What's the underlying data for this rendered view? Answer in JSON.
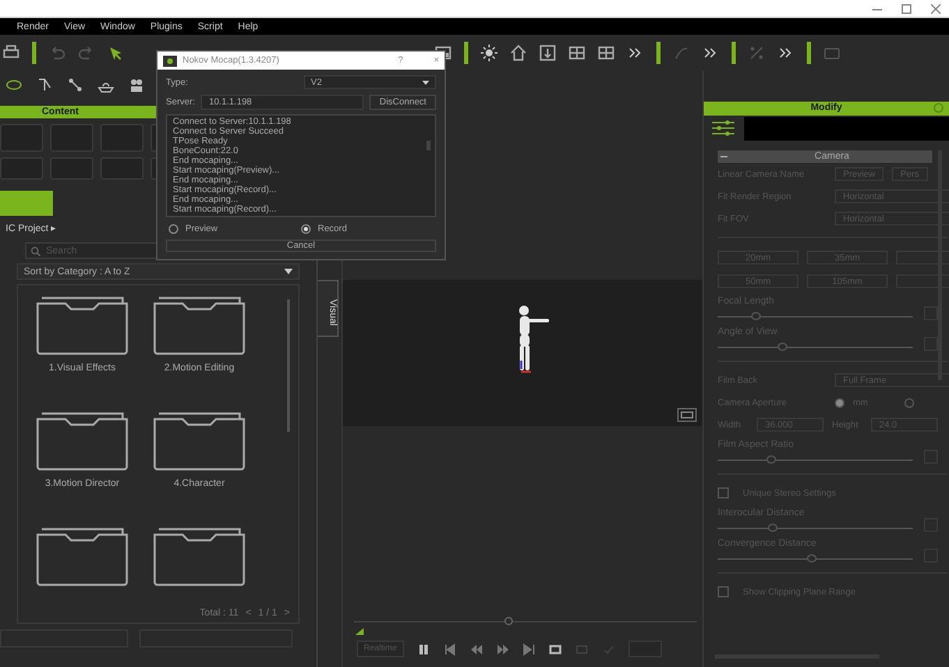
{
  "menu": [
    "Render",
    "View",
    "Window",
    "Plugins",
    "Script",
    "Help"
  ],
  "content_panel": {
    "title": "Content",
    "project": "IC Project ▸",
    "search": {
      "placeholder": "Search"
    },
    "sort": "Sort by Category : A to Z",
    "folders": [
      {
        "kind": "labeled",
        "label": "1.Visual Effects"
      },
      {
        "kind": "labeled",
        "label": "2.Motion Editing"
      },
      {
        "kind": "labeled",
        "label": "3.Motion Director"
      },
      {
        "kind": "labeled",
        "label": "4.Character"
      },
      {
        "kind": "cut"
      },
      {
        "kind": "cut"
      }
    ],
    "total": "Total : 11",
    "pager": {
      "prev": "<",
      "page": "1 / 1",
      "next": ">"
    }
  },
  "side_tab": {
    "label": "Visual",
    "selected": true
  },
  "timeline": {
    "level": 0.45,
    "realtime": "Realtime"
  },
  "modify_panel": {
    "title": "Modify",
    "section": "Camera",
    "rows": [
      {
        "kind": "buttons",
        "label": "Linear Camera Name",
        "buttons": [
          "Preview",
          "Pers"
        ]
      },
      {
        "kind": "select",
        "label": "Fit Render Region",
        "value": "Horizontal"
      },
      {
        "kind": "select",
        "label": "Fit FOV",
        "value": "Horizontal"
      },
      {
        "kind": "divider"
      },
      {
        "kind": "presets",
        "buttons": [
          "20mm",
          "35mm"
        ]
      },
      {
        "kind": "presets",
        "buttons": [
          "50mm",
          "105mm"
        ]
      },
      {
        "kind": "slider",
        "label": "Focal Length",
        "level": 0.19
      },
      {
        "kind": "slider",
        "label": "Angle of View",
        "level": 0.33
      },
      {
        "kind": "divider"
      },
      {
        "kind": "select",
        "label": "Film Back",
        "value": "Full Frame"
      },
      {
        "kind": "radio",
        "label": "Camera Aperture",
        "options": [
          {
            "label": "mm",
            "selected": true
          },
          {
            "selected": false
          }
        ]
      },
      {
        "kind": "fields",
        "items": [
          {
            "label": "Width",
            "value": "36.000"
          },
          {
            "label": "Height",
            "value": "24.0"
          }
        ]
      },
      {
        "kind": "slider",
        "label": "Film Aspect Ratio",
        "level": 0.27
      },
      {
        "kind": "divider"
      },
      {
        "kind": "checkbox",
        "label": "Unique Stereo Settings",
        "checked": false
      },
      {
        "kind": "slider",
        "label": "Interocular Distance",
        "level": 0.28
      },
      {
        "kind": "slider",
        "label": "Convergence Distance",
        "level": 0.48
      },
      {
        "kind": "divider"
      },
      {
        "kind": "checkbox",
        "label": "Show Clipping Plane Range",
        "checked": false
      }
    ]
  },
  "dialog": {
    "title": "Nokov Mocap(1.3.4207)",
    "help": "?",
    "close": "×",
    "type_label": "Type:",
    "type_value": "V2",
    "server_label": "Server:",
    "server_value": "10.1.1.198",
    "connect_button": "DisConnect",
    "log": [
      "Connect to Server:10.1.1.198",
      "Connect to Server Succeed",
      "TPose Ready",
      "BoneCount:22.0",
      "End mocaping...",
      "Start mocaping(Preview)...",
      "End mocaping...",
      "Start mocaping(Record)...",
      "End mocaping...",
      "Start mocaping(Record)..."
    ],
    "modes": [
      {
        "label": "Preview",
        "selected": false
      },
      {
        "label": "Record",
        "selected": true
      }
    ],
    "cancel_button": "Cancel"
  }
}
